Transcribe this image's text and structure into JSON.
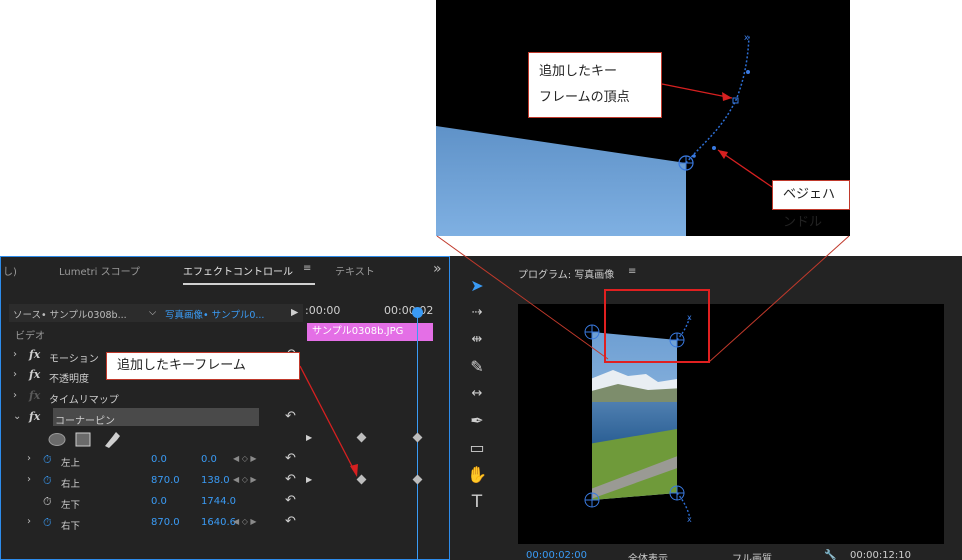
{
  "zoom_callouts": {
    "keyframe_vertex_line1": "追加したキー",
    "keyframe_vertex_line2": "フレームの頂点",
    "bezier_handle": "ベジェハンドル"
  },
  "main_callout": "追加したキーフレーム",
  "effect_panel": {
    "tabs": [
      "し)",
      "Lumetri スコープ",
      "エフェクトコントロール",
      "テキスト"
    ],
    "active_tab_index": 2,
    "menu_icon": "≡",
    "overflow_icon": "»",
    "source_label": "ソース• サンプル0308b...",
    "target_label": "写真画像• サンプル0...",
    "video_label": "ビデオ",
    "motion": "モーション",
    "opacity": "不透明度",
    "time_remap": "タイムリマップ",
    "corner_pin": "コーナーピン",
    "params": [
      {
        "name": "左上",
        "x": "0.0",
        "y": "0.0",
        "animated": true,
        "expand": true
      },
      {
        "name": "右上",
        "x": "870.0",
        "y": "138.0",
        "animated": true,
        "expand": true
      },
      {
        "name": "左下",
        "x": "0.0",
        "y": "1744.0",
        "animated": false,
        "expand": false
      },
      {
        "name": "右下",
        "x": "870.0",
        "y": "1640.6",
        "animated": true,
        "expand": true
      }
    ]
  },
  "timeline": {
    "time_start": ":00:00",
    "time_end": "00:00:02",
    "clip_name": "サンプル0308b.JPG"
  },
  "program": {
    "title": "プログラム: 写真画像",
    "timecode_left": "00:00:02:00",
    "fit_label": "全体表示",
    "quality_label": "フル画質",
    "timecode_right": "00:00:12:10"
  },
  "colors": {
    "accent": "#3a9bf5",
    "callout_border": "#c0392b",
    "clip": "#e46fe6",
    "panel_bg": "#232323"
  }
}
